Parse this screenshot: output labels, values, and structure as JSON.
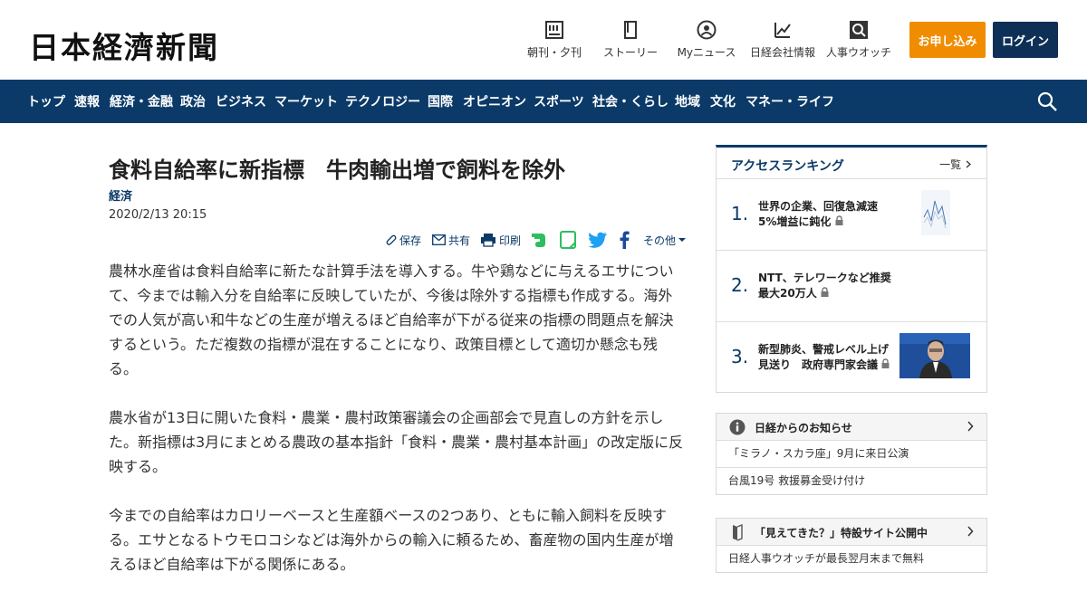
{
  "header": {
    "logo": "日本経濟新聞",
    "nav": [
      {
        "label": "朝刊・夕刊",
        "icon": "newspaper-icon"
      },
      {
        "label": "ストーリー",
        "icon": "book-icon"
      },
      {
        "label": "Myニュース",
        "icon": "user-icon"
      },
      {
        "label": "日経会社情報",
        "icon": "chart-icon"
      },
      {
        "label": "人事ウオッチ",
        "icon": "magnifier-icon"
      }
    ],
    "subscribe_label": "お申し込み",
    "login_label": "ログイン"
  },
  "navbar": {
    "items": [
      "トップ",
      "速報",
      "経済・金融",
      "政治",
      "ビジネス",
      "マーケット",
      "テクノロジー",
      "国際",
      "オピニオン",
      "スポーツ",
      "社会・くらし",
      "地域",
      "文化",
      "マネー・ライフ"
    ]
  },
  "article": {
    "title": "食料自給率に新指標　牛肉輸出増で飼料を除外",
    "category": "経済",
    "date": "2020/2/13 20:15",
    "tools": {
      "save": "保存",
      "share": "共有",
      "print": "印刷",
      "other": "その他"
    },
    "paragraphs": [
      "農林水産省は食料自給率に新たな計算手法を導入する。牛や鶏などに与えるエサについて、今までは輸入分を自給率に反映していたが、今後は除外する指標も作成する。海外での人気が高い和牛などの生産が増えるほど自給率が下がる従来の指標の問題点を解決するという。ただ複数の指標が混在することになり、政策目標として適切か懸念も残る。",
      "農水省が13日に開いた食料・農業・農村政策審議会の企画部会で見直しの方針を示した。新指標は3月にまとめる農政の基本指針「食料・農業・農村基本計画」の改定版に反映する。",
      "今までの自給率はカロリーベースと生産額ベースの2つあり、ともに輸入飼料を反映する。エサとなるトウモロコシなどは海外からの輸入に頼るため、畜産物の国内生産が増えるほど自給率は下がる関係にある。"
    ]
  },
  "ranking": {
    "title": "アクセスランキング",
    "more": "一覧",
    "items": [
      {
        "rank": "1.",
        "text": "世界の企業、回復急減速 5%増益に鈍化"
      },
      {
        "rank": "2.",
        "text": "NTT、テレワークなど推奨　最大20万人"
      },
      {
        "rank": "3.",
        "text": "新型肺炎、警戒レベル上げ見送り　政府専門家会議"
      }
    ]
  },
  "notice": {
    "title": "日経からのお知らせ",
    "items": [
      "「ミラノ・スカラ座」9月に来日公演",
      "台風19号 救援募金受け付け"
    ]
  },
  "promo": {
    "title": "「見えてきた？」特設サイト公開中",
    "items": [
      "日経人事ウオッチが最長翌月末まで無料"
    ]
  },
  "colors": {
    "navy": "#0b3a68",
    "orange": "#f08c00",
    "login": "#0e2f56",
    "evernote": "#2dbe60",
    "twitter": "#1da1f2",
    "facebook": "#1a4a9a"
  }
}
